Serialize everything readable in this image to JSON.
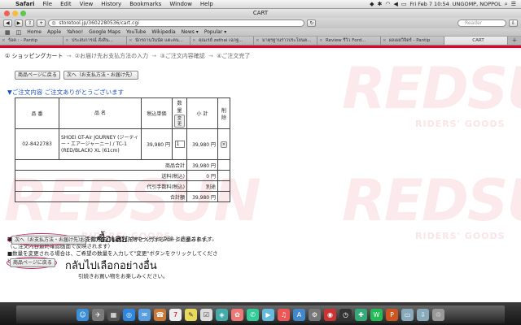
{
  "menubar": {
    "app": "Safari",
    "items": [
      "File",
      "Edit",
      "View",
      "History",
      "Bookmarks",
      "Window",
      "Help"
    ],
    "clock": "Fri Feb 7  10:54",
    "user": "UNGOMP, NOPPOL"
  },
  "window": {
    "title": "CART"
  },
  "toolbar": {
    "url": "storetool.jp/3602280536/cart.cgi",
    "search_placeholder": "Reader"
  },
  "bookmarks": [
    "Home",
    "Apple",
    "Yahoo!",
    "Google Maps",
    "YouTube",
    "Wikipedia",
    "News ▾",
    "Popular ▾"
  ],
  "tabs": [
    {
      "label": "ร้อค : - Pantip",
      "active": false
    },
    {
      "label": "ประสบการณ์ สั่งสิน...",
      "active": false
    },
    {
      "label": "นักรถานวันนัด แตะคน...",
      "active": false
    },
    {
      "label": "คุณเรย์ zethai เฉกฐ...",
      "active": false
    },
    {
      "label": "มาตุรฐานร่าวประโยนต...",
      "active": false
    },
    {
      "label": "Review รีวิว Ford...",
      "active": false
    },
    {
      "label": "ผลเผยวิจิตร์ - Pantip",
      "active": false
    },
    {
      "label": "CART",
      "active": true
    }
  ],
  "steps": [
    "① ショッピングカート",
    "②お届け先お支払方法の入力",
    "③ご注文内容確認",
    "④ご注文完了"
  ],
  "watermark": {
    "brand": "REDSUN",
    "tagline": "RIDERS' GOODS"
  },
  "buttons": {
    "back_to_product": "商品ページに戻る",
    "next_top": "次へ（お支払方法・お届け先）",
    "next_bottom": "次へ（お支払方法・お届け先）",
    "back_bottom": "商品ページに戻る",
    "change_qty": "変更"
  },
  "order": {
    "heading": "▼ご注文内容  ご注文ありがとうございます",
    "headers": {
      "code": "品 番",
      "name": "品 名",
      "price": "税込単価",
      "qty": "数 量",
      "subtotal": "小 計",
      "delete": "削除"
    },
    "item": {
      "code": "02-8422783",
      "name": "SHOEI GT-Air JOURNEY (ジーティー・エアージャーニー) / TC-1 (RED/BLACK) XL (61cm)",
      "price": "39,980 円",
      "qty": "1",
      "subtotal": "39,980 円",
      "delete": "×"
    },
    "summary": [
      {
        "label": "商品合計",
        "value": "39,980 円"
      },
      {
        "label": "送料(税込)",
        "value": "0 円"
      },
      {
        "label": "代引手数料(税込)",
        "value": "別途"
      },
      {
        "label": "合計額",
        "value": "39,980 円"
      }
    ]
  },
  "notes": [
    "■お支払方法にかかわらず、代引手数料について このページでは 別途 と表示されます。",
    "（ご注文内容最終確認画面で反映されます）",
    "■数量を変更される場合は、ご希望の数量を入力して\"変更\"ボタンをクリックしてください。"
  ],
  "bottom_texts": {
    "next_desc": "お支払方法、お届け先等を入力するページに進みます。",
    "back_desc": "引続きお買い物をお楽しみください。"
  },
  "annotations": {
    "buy": "ซื้อเลย",
    "back": "กลับไปเลือกอย่างอื่น"
  },
  "colors": {
    "link_blue": "#1a4fc9",
    "brand_red": "#e4002b",
    "annotation_ring": "#d6245e"
  }
}
